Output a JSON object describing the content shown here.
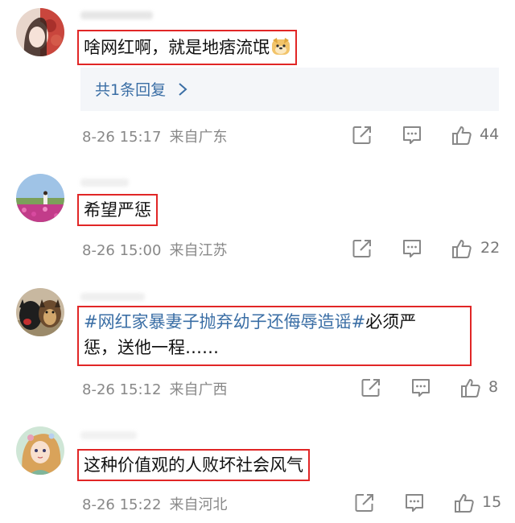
{
  "comments": [
    {
      "text": "啥网红啊，就是地痞流氓",
      "reply_link": "共1条回复",
      "date": "8-26 15:17",
      "source": "来自广东",
      "likes": "44"
    },
    {
      "text": "希望严惩",
      "date": "8-26 15:00",
      "source": "来自江苏",
      "likes": "22"
    },
    {
      "topic": "#网红家暴妻子抛弃幼子还侮辱造谣#",
      "text_after_topic": "必须严",
      "text_line2": "惩，送他一程……",
      "date": "8-26 15:12",
      "source": "来自广西",
      "likes": "8"
    },
    {
      "text": "这种价值观的人败坏社会风气",
      "date": "8-26 15:22",
      "source": "来自河北",
      "likes": "15"
    }
  ],
  "icons": {
    "share": "share-icon",
    "comment": "comment-icon",
    "like": "thumbs-up-icon",
    "emoji": "dog-face-emoji"
  },
  "colors": {
    "highlight_border": "#e12626",
    "topic_link": "#3a6ea5",
    "meta_gray": "#888888",
    "reply_bg": "#f4f6f9"
  }
}
